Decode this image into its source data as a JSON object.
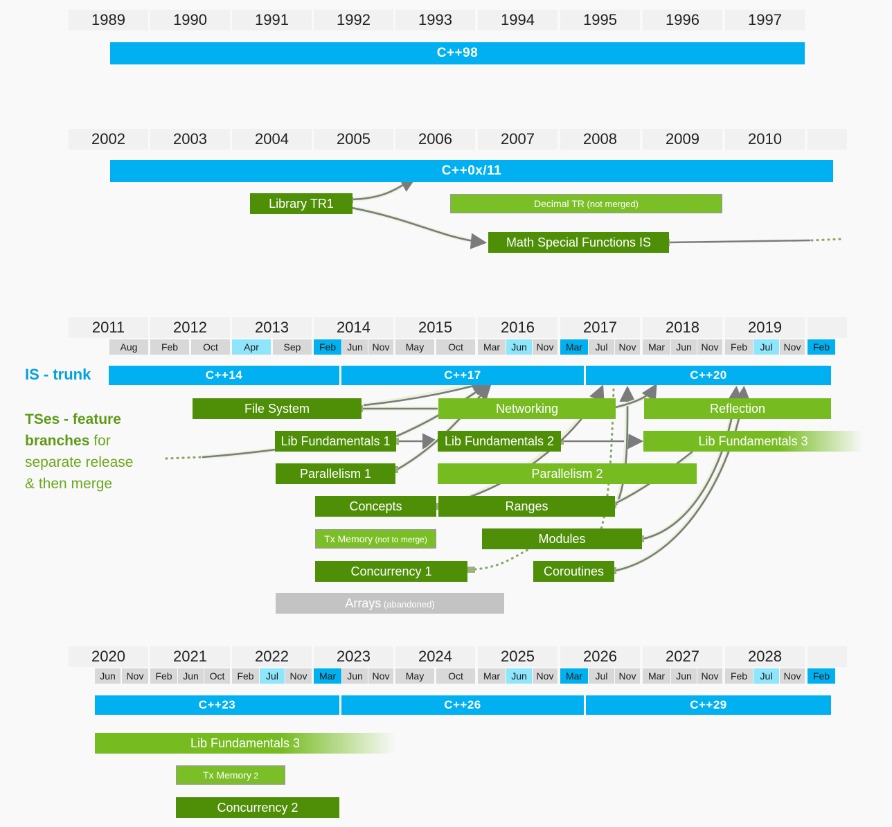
{
  "title": "C++ standards and Technical Specifications timeline",
  "colors": {
    "trunk_blue": "#00b0f0",
    "ts_dark_green": "#4e8f07",
    "ts_light_green": "#76bc21",
    "abandoned_gray": "#c3c3c3",
    "month_default": "#d8d8d8",
    "month_light_highlight": "#8fe6fb",
    "month_strong_highlight": "#00b0ef",
    "caption_blue": "#00a2e0",
    "caption_green": "#6aa81c"
  },
  "captions": {
    "is_trunk": "IS - trunk",
    "tses_line1_bold": "TSes - feature",
    "tses_line2_bold": "branches",
    "tses_line2_rest": " for",
    "tses_line3": "separate release",
    "tses_line4": "& then merge"
  },
  "sections": [
    {
      "id": "band-1989",
      "years": [
        "1989",
        "1990",
        "1991",
        "1992",
        "1993",
        "1994",
        "1995",
        "1996",
        "1997"
      ],
      "months": [],
      "trunk": [
        {
          "label": "C++98"
        }
      ],
      "ts": []
    },
    {
      "id": "band-2002",
      "years": [
        "2002",
        "2003",
        "2004",
        "2005",
        "2006",
        "2007",
        "2008",
        "2009",
        "2010",
        ""
      ],
      "months": [],
      "trunk": [
        {
          "label": "C++0x/11"
        }
      ],
      "ts": [
        {
          "label": "Library TR1",
          "style": "dark"
        },
        {
          "label": "Decimal TR",
          "note": " (not merged)",
          "style": "dashed"
        },
        {
          "label": "Math Special Functions IS",
          "style": "dark"
        }
      ]
    },
    {
      "id": "band-2011",
      "years": [
        "2011",
        "2012",
        "2013",
        "2014",
        "2015",
        "2016",
        "2017",
        "2018",
        "2019",
        ""
      ],
      "months": [
        {
          "label": "Aug",
          "hl": "none"
        },
        {
          "label": "Feb",
          "hl": "none"
        },
        {
          "label": "Oct",
          "hl": "none"
        },
        {
          "label": "Apr",
          "hl": "light"
        },
        {
          "label": "Sep",
          "hl": "none"
        },
        {
          "label": "Feb",
          "hl": "strong"
        },
        {
          "label": "Jun",
          "hl": "none"
        },
        {
          "label": "Nov",
          "hl": "none"
        },
        {
          "label": "May",
          "hl": "none"
        },
        {
          "label": "Oct",
          "hl": "none"
        },
        {
          "label": "Mar",
          "hl": "none"
        },
        {
          "label": "Jun",
          "hl": "light"
        },
        {
          "label": "Nov",
          "hl": "none"
        },
        {
          "label": "Mar",
          "hl": "strong"
        },
        {
          "label": "Jul",
          "hl": "none"
        },
        {
          "label": "Nov",
          "hl": "none"
        },
        {
          "label": "Mar",
          "hl": "none"
        },
        {
          "label": "Jun",
          "hl": "none"
        },
        {
          "label": "Nov",
          "hl": "none"
        },
        {
          "label": "Feb",
          "hl": "none"
        },
        {
          "label": "Jul",
          "hl": "light"
        },
        {
          "label": "Nov",
          "hl": "none"
        },
        {
          "label": "Feb",
          "hl": "strong"
        }
      ],
      "trunk": [
        {
          "label": "C++14"
        },
        {
          "label": "C++17"
        },
        {
          "label": "C++20"
        }
      ],
      "ts": [
        {
          "label": "File System",
          "style": "dark"
        },
        {
          "label": "Networking",
          "style": "light"
        },
        {
          "label": "Reflection",
          "style": "light"
        },
        {
          "label": "Lib Fundamentals 1",
          "style": "dark"
        },
        {
          "label": "Lib Fundamentals 2",
          "style": "dark"
        },
        {
          "label": "Lib Fundamentals 3",
          "style": "fade"
        },
        {
          "label": "Parallelism 1",
          "style": "dark"
        },
        {
          "label": "Parallelism 2",
          "style": "light"
        },
        {
          "label": "Concepts",
          "style": "dark"
        },
        {
          "label": "Ranges",
          "style": "dark"
        },
        {
          "label": "Tx Memory",
          "note": " (not to merge)",
          "style": "dashed"
        },
        {
          "label": "Modules",
          "style": "dark"
        },
        {
          "label": "Concurrency 1",
          "style": "dark"
        },
        {
          "label": "Coroutines",
          "style": "dark"
        },
        {
          "label": "Arrays",
          "note": " (abandoned)",
          "style": "gray"
        }
      ]
    },
    {
      "id": "band-2020",
      "years": [
        "2020",
        "2021",
        "2022",
        "2023",
        "2024",
        "2025",
        "2026",
        "2027",
        "2028",
        ""
      ],
      "months": [
        {
          "label": "Jun",
          "hl": "none"
        },
        {
          "label": "Nov",
          "hl": "none"
        },
        {
          "label": "Feb",
          "hl": "none"
        },
        {
          "label": "Jun",
          "hl": "none"
        },
        {
          "label": "Oct",
          "hl": "none"
        },
        {
          "label": "Feb",
          "hl": "none"
        },
        {
          "label": "Jul",
          "hl": "light"
        },
        {
          "label": "Nov",
          "hl": "none"
        },
        {
          "label": "Mar",
          "hl": "strong"
        },
        {
          "label": "Jun",
          "hl": "none"
        },
        {
          "label": "Nov",
          "hl": "none"
        },
        {
          "label": "May",
          "hl": "none"
        },
        {
          "label": "Oct",
          "hl": "none"
        },
        {
          "label": "Mar",
          "hl": "none"
        },
        {
          "label": "Jun",
          "hl": "light"
        },
        {
          "label": "Nov",
          "hl": "none"
        },
        {
          "label": "Mar",
          "hl": "strong"
        },
        {
          "label": "Jul",
          "hl": "none"
        },
        {
          "label": "Nov",
          "hl": "none"
        },
        {
          "label": "Mar",
          "hl": "none"
        },
        {
          "label": "Jun",
          "hl": "none"
        },
        {
          "label": "Nov",
          "hl": "none"
        },
        {
          "label": "Feb",
          "hl": "none"
        },
        {
          "label": "Jul",
          "hl": "light"
        },
        {
          "label": "Nov",
          "hl": "none"
        },
        {
          "label": "Feb",
          "hl": "strong"
        }
      ],
      "trunk": [
        {
          "label": "C++23"
        },
        {
          "label": "C++26"
        },
        {
          "label": "C++29"
        }
      ],
      "ts": [
        {
          "label": "Lib Fundamentals 3",
          "style": "fade"
        },
        {
          "label": "Tx Memory",
          "note": " 2",
          "style": "dashed"
        },
        {
          "label": "Concurrency 2",
          "style": "dark"
        }
      ]
    }
  ],
  "bars": {
    "cpp98": "C++98",
    "cpp0x11": "C++0x/11",
    "library_tr1": "Library TR1",
    "decimal_tr": "Decimal TR",
    "decimal_tr_note": " (not merged)",
    "math_special": "Math Special Functions IS",
    "cpp14": "C++14",
    "cpp17": "C++17",
    "cpp20": "C++20",
    "cpp23": "C++23",
    "cpp26": "C++26",
    "cpp29": "C++29",
    "file_system": "File System",
    "networking": "Networking",
    "reflection": "Reflection",
    "libfund1": "Lib Fundamentals 1",
    "libfund2": "Lib Fundamentals 2",
    "libfund3": "Lib Fundamentals 3",
    "parallelism1": "Parallelism 1",
    "parallelism2": "Parallelism 2",
    "concepts": "Concepts",
    "ranges": "Ranges",
    "txmem": "Tx Memory",
    "txmem_note": " (not to merge)",
    "modules": "Modules",
    "concurrency1": "Concurrency 1",
    "coroutines": "Coroutines",
    "arrays": "Arrays",
    "arrays_note": " (abandoned)",
    "libfund3_b": "Lib Fundamentals 3",
    "txmem2": "Tx Memory",
    "txmem2_note": " 2",
    "concurrency2": "Concurrency 2"
  }
}
